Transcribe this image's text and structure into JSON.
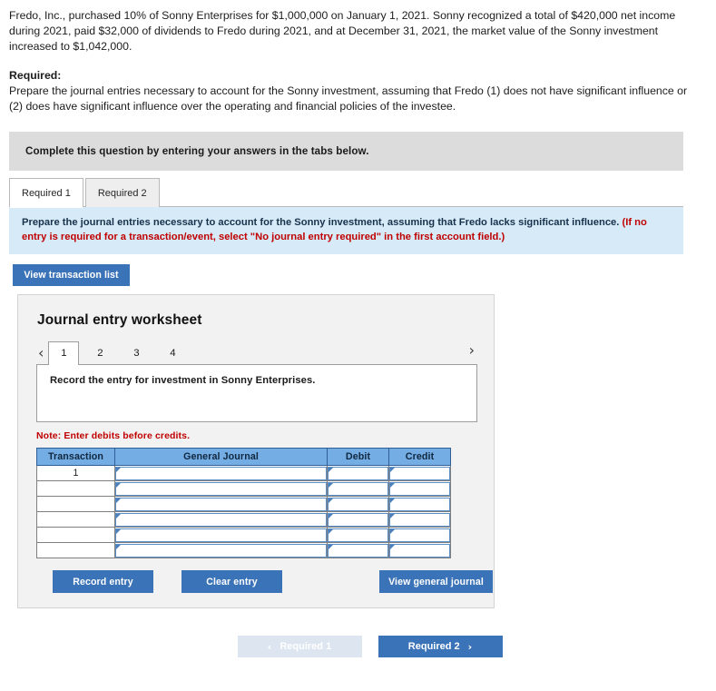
{
  "problem": {
    "paragraph": "Fredo, Inc., purchased 10% of Sonny Enterprises for $1,000,000 on January 1, 2021. Sonny recognized a total of $420,000 net income during 2021, paid $32,000 of dividends to Fredo during 2021, and at December 31, 2021, the market value of the Sonny investment increased to $1,042,000.",
    "required_label": "Required:",
    "required_text": "Prepare the journal entries necessary to account for the Sonny investment, assuming that Fredo (1) does not have significant influence or (2) does have significant influence over the operating and financial policies of the investee."
  },
  "banner": {
    "text": "Complete this question by entering your answers in the tabs below."
  },
  "tabs": [
    {
      "label": "Required 1",
      "active": true
    },
    {
      "label": "Required 2",
      "active": false
    }
  ],
  "instruction": {
    "main": "Prepare the journal entries necessary to account for the Sonny investment, assuming that Fredo lacks significant influence.",
    "hint": "(If no entry is required for a transaction/event, select \"No journal entry required\" in the first account field.)"
  },
  "toolbar": {
    "view_transaction_list": "View transaction list"
  },
  "worksheet": {
    "title": "Journal entry worksheet",
    "pager": {
      "prev_icon": "chevron-left-icon",
      "next_icon": "chevron-right-icon",
      "pages": [
        "1",
        "2",
        "3",
        "4"
      ],
      "active_page": "1"
    },
    "entry_description": "Record the entry for investment in Sonny Enterprises.",
    "note": "Note: Enter debits before credits.",
    "table": {
      "headers": [
        "Transaction",
        "General Journal",
        "Debit",
        "Credit"
      ],
      "rows": [
        {
          "transaction": "1",
          "general_journal": "",
          "debit": "",
          "credit": ""
        },
        {
          "transaction": "",
          "general_journal": "",
          "debit": "",
          "credit": ""
        },
        {
          "transaction": "",
          "general_journal": "",
          "debit": "",
          "credit": ""
        },
        {
          "transaction": "",
          "general_journal": "",
          "debit": "",
          "credit": ""
        },
        {
          "transaction": "",
          "general_journal": "",
          "debit": "",
          "credit": ""
        },
        {
          "transaction": "",
          "general_journal": "",
          "debit": "",
          "credit": ""
        }
      ]
    },
    "actions": {
      "record_entry": "Record entry",
      "clear_entry": "Clear entry",
      "view_general_journal": "View general journal"
    }
  },
  "bottom_nav": {
    "prev_label": "Required 1",
    "next_label": "Required 2",
    "prev_icon": "chevron-left-icon",
    "next_icon": "chevron-right-icon",
    "prev_enabled": false,
    "next_enabled": true
  },
  "colors": {
    "primary_blue": "#3b73b9",
    "table_header_blue": "#74ade4",
    "instruction_blue": "#d6eaf8",
    "banner_gray": "#dcdcdc",
    "note_red": "#c00000",
    "disabled_blue": "#dce5f0"
  }
}
